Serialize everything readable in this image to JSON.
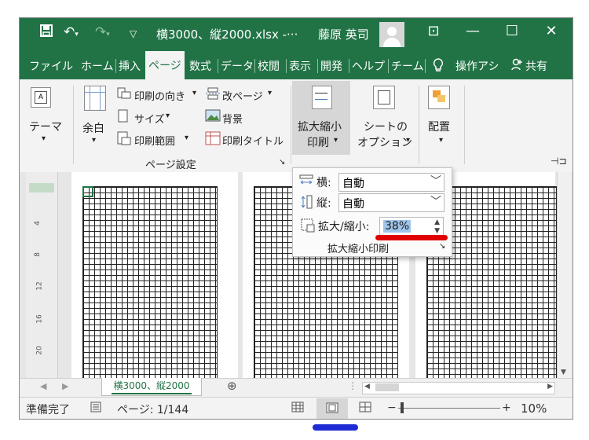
{
  "window": {
    "title": "横3000、縦2000.xlsx  -···",
    "user": "藤原 英司"
  },
  "title_controls": {
    "restore_ribbon": "⊡",
    "minimize": "—",
    "maximize": "☐",
    "close": "✕"
  },
  "tabs": [
    "ファイル",
    "ホーム",
    "挿入",
    "ページ",
    "数式",
    "データ",
    "校閲",
    "表示",
    "開発",
    "ヘルプ",
    "チーム",
    "操作アシ",
    "共有"
  ],
  "active_tab": "ページ",
  "ribbon": {
    "themes_label": "テーマ",
    "margins_label": "余白",
    "orientation_label": "印刷の向き",
    "size_label": "サイズ",
    "print_area_label": "印刷範囲",
    "breaks_label": "改ページ",
    "background_label": "背景",
    "print_titles_label": "印刷タイトル",
    "page_setup_group": "ページ設定",
    "scale_fit_label_1": "拡大縮小",
    "scale_fit_label_2": "印刷",
    "sheet_options_label_1": "シートの",
    "sheet_options_label_2": "オプション",
    "arrange_label": "配置",
    "dropdown_caret": "▾"
  },
  "scale_panel": {
    "width_label": "横:",
    "width_value": "自動",
    "height_label": "縦:",
    "height_value": "自動",
    "scale_label": "拡大/縮小:",
    "scale_value": "38%",
    "group_label": "拡大縮小印刷"
  },
  "ruler": [
    "4",
    "8",
    "12",
    "16",
    "20"
  ],
  "sheet_tab": "横3000、縦2000",
  "status": {
    "ready": "準備完了",
    "page": "ページ: 1/144",
    "zoom": "10%",
    "zoom_minus": "−",
    "zoom_plus": "+"
  },
  "colors": {
    "excel_green": "#217346",
    "annotation_red": "#e00000",
    "annotation_blue": "#1f2cd6"
  }
}
